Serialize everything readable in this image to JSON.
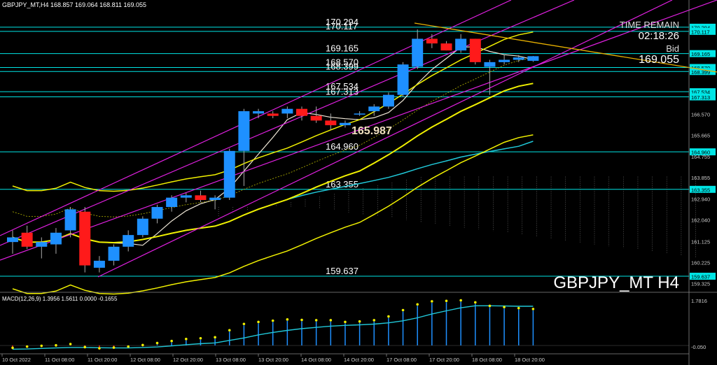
{
  "header": {
    "text": "GBPJPY_MT,H4  168.857 169.064 168.811 169.055"
  },
  "info": {
    "time_remain_label": "TIME REMAIN",
    "time_remain_value": "02:18:26",
    "bid_label": "Bid",
    "bid_value": "169.055"
  },
  "symbol_label": "GBPJPY_MT H4",
  "macd_label": "MACD(12,26,9) 1.3956 1.5611 0.0000 -0.1655",
  "colors": {
    "bull": "#1e90ff",
    "bear": "#ff1a1a",
    "level": "#00e5e5",
    "band": "#f0f000",
    "channel": "#e020e0",
    "ma": "#20c8d8",
    "trend": "#e8b000"
  },
  "chart_data": {
    "type": "candlestick",
    "symbol": "GBPJPY_MT",
    "timeframe": "H4",
    "y_range": [
      158.95,
      171.1
    ],
    "price_ticks": [
      170.294,
      170.117,
      169.165,
      168.57,
      168.399,
      167.534,
      167.313,
      166.57,
      165.665,
      164.96,
      164.755,
      163.855,
      163.355,
      162.94,
      162.04,
      161.125,
      160.225,
      159.637,
      159.325
    ],
    "time_labels": [
      "10 Oct 2022",
      "11 Oct 08:00",
      "11 Oct 20:00",
      "12 Oct 08:00",
      "12 Oct 20:00",
      "13 Oct 08:00",
      "13 Oct 20:00",
      "14 Oct 08:00",
      "14 Oct 20:00",
      "17 Oct 08:00",
      "17 Oct 20:00",
      "18 Oct 08:00",
      "18 Oct 20:00"
    ],
    "levels": [
      {
        "label": "170.294",
        "value": 170.294
      },
      {
        "label": "170.117",
        "value": 170.117
      },
      {
        "label": "169.165",
        "value": 169.165
      },
      {
        "label": "168.570",
        "value": 168.57
      },
      {
        "label": "168.399",
        "value": 168.399
      },
      {
        "label": "167.534",
        "value": 167.534
      },
      {
        "label": "167.313",
        "value": 167.313
      },
      {
        "label": "164.960",
        "value": 164.96
      },
      {
        "label": "163.355",
        "value": 163.355
      },
      {
        "label": "159.637",
        "value": 159.637
      }
    ],
    "highlight_price": "165.987",
    "candles": [
      {
        "o": 161.1,
        "h": 161.6,
        "l": 160.6,
        "c": 161.3
      },
      {
        "o": 161.5,
        "h": 161.8,
        "l": 160.8,
        "c": 160.9
      },
      {
        "o": 160.9,
        "h": 161.3,
        "l": 160.4,
        "c": 161.1
      },
      {
        "o": 161.0,
        "h": 161.7,
        "l": 160.6,
        "c": 161.5
      },
      {
        "o": 161.6,
        "h": 162.6,
        "l": 161.3,
        "c": 162.5
      },
      {
        "o": 162.4,
        "h": 162.6,
        "l": 159.8,
        "c": 160.1
      },
      {
        "o": 160.0,
        "h": 160.5,
        "l": 159.8,
        "c": 160.3
      },
      {
        "o": 160.3,
        "h": 161.0,
        "l": 160.1,
        "c": 160.9
      },
      {
        "o": 160.9,
        "h": 161.6,
        "l": 160.7,
        "c": 161.4
      },
      {
        "o": 161.4,
        "h": 162.2,
        "l": 161.3,
        "c": 162.1
      },
      {
        "o": 162.1,
        "h": 162.7,
        "l": 161.9,
        "c": 162.6
      },
      {
        "o": 162.6,
        "h": 163.1,
        "l": 162.4,
        "c": 163.0
      },
      {
        "o": 163.0,
        "h": 163.2,
        "l": 162.8,
        "c": 163.1
      },
      {
        "o": 163.1,
        "h": 163.3,
        "l": 162.8,
        "c": 162.9
      },
      {
        "o": 162.9,
        "h": 163.1,
        "l": 162.5,
        "c": 163.0
      },
      {
        "o": 163.0,
        "h": 165.1,
        "l": 162.9,
        "c": 165.0
      },
      {
        "o": 165.0,
        "h": 166.8,
        "l": 163.5,
        "c": 166.7
      },
      {
        "o": 166.6,
        "h": 166.8,
        "l": 166.4,
        "c": 166.7
      },
      {
        "o": 166.6,
        "h": 166.7,
        "l": 166.4,
        "c": 166.5
      },
      {
        "o": 166.6,
        "h": 166.9,
        "l": 166.4,
        "c": 166.8
      },
      {
        "o": 166.8,
        "h": 166.9,
        "l": 166.3,
        "c": 166.5
      },
      {
        "o": 166.5,
        "h": 166.9,
        "l": 166.2,
        "c": 166.3
      },
      {
        "o": 166.3,
        "h": 166.6,
        "l": 165.9,
        "c": 166.1
      },
      {
        "o": 166.1,
        "h": 166.3,
        "l": 166.0,
        "c": 166.2
      },
      {
        "o": 166.6,
        "h": 166.7,
        "l": 166.5,
        "c": 166.6
      },
      {
        "o": 166.7,
        "h": 167.0,
        "l": 166.5,
        "c": 166.9
      },
      {
        "o": 166.9,
        "h": 167.5,
        "l": 166.8,
        "c": 167.4
      },
      {
        "o": 167.4,
        "h": 168.8,
        "l": 167.3,
        "c": 168.7
      },
      {
        "o": 168.6,
        "h": 170.2,
        "l": 168.5,
        "c": 169.8
      },
      {
        "o": 169.8,
        "h": 170.0,
        "l": 169.4,
        "c": 169.6
      },
      {
        "o": 169.6,
        "h": 169.7,
        "l": 169.3,
        "c": 169.3
      },
      {
        "o": 169.3,
        "h": 170.0,
        "l": 169.2,
        "c": 169.8
      },
      {
        "o": 169.8,
        "h": 169.8,
        "l": 168.7,
        "c": 168.8
      },
      {
        "o": 168.6,
        "h": 168.9,
        "l": 167.4,
        "c": 168.8
      },
      {
        "o": 168.8,
        "h": 169.1,
        "l": 168.7,
        "c": 168.9
      },
      {
        "o": 168.9,
        "h": 169.1,
        "l": 168.8,
        "c": 169.0
      },
      {
        "o": 168.857,
        "h": 169.064,
        "l": 168.811,
        "c": 169.055
      }
    ],
    "macd": {
      "label": "MACD(12,26,9)",
      "values": [
        1.3956,
        1.5611,
        0.0,
        -0.1655
      ],
      "ticks": [
        "1.7816",
        "-0.050"
      ],
      "range": [
        -0.25,
        1.95
      ],
      "histogram": [
        -0.15,
        -0.1,
        -0.07,
        -0.05,
        0.0,
        -0.12,
        -0.17,
        -0.14,
        -0.1,
        -0.04,
        0.04,
        0.12,
        0.2,
        0.23,
        0.27,
        0.55,
        0.8,
        0.88,
        0.93,
        0.98,
        0.96,
        0.95,
        0.95,
        0.88,
        0.9,
        0.95,
        1.1,
        1.35,
        1.58,
        1.7,
        1.72,
        1.74,
        1.66,
        1.52,
        1.47,
        1.43,
        1.3956
      ],
      "signal": [
        -0.15,
        -0.14,
        -0.12,
        -0.1,
        -0.08,
        -0.08,
        -0.09,
        -0.1,
        -0.1,
        -0.08,
        -0.06,
        -0.02,
        0.03,
        0.07,
        0.1,
        0.2,
        0.3,
        0.42,
        0.52,
        0.6,
        0.67,
        0.72,
        0.77,
        0.8,
        0.82,
        0.85,
        0.9,
        0.98,
        1.1,
        1.25,
        1.38,
        1.5,
        1.58,
        1.58,
        1.57,
        1.56,
        1.5611
      ]
    }
  }
}
